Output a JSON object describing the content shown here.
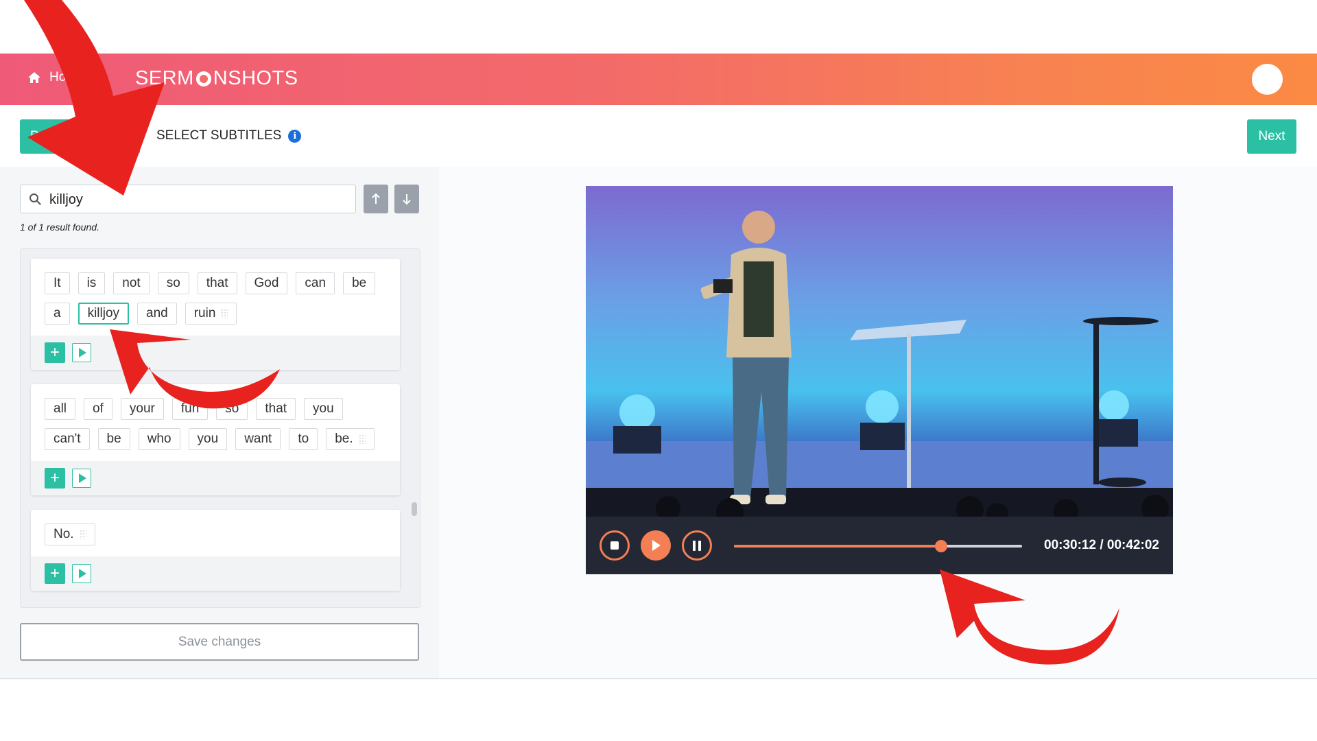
{
  "header": {
    "home_label": "Home",
    "logo_left": "SERM",
    "logo_right": "NSHOTS"
  },
  "toolbar": {
    "previous_label": "Previous",
    "step_title": "SELECT SUBTITLES",
    "info_icon": "info-icon",
    "next_label": "Next"
  },
  "search": {
    "value": "killjoy",
    "result_text": "1 of 1 result found."
  },
  "subtitles": [
    {
      "words": [
        "It",
        "is",
        "not",
        "so",
        "that",
        "God",
        "can",
        "be",
        "a",
        "killjoy",
        "and",
        "ruin"
      ],
      "highlight": "killjoy"
    },
    {
      "words": [
        "all",
        "of",
        "your",
        "fun",
        "so",
        "that",
        "you",
        "can't",
        "be",
        "who",
        "you",
        "want",
        "to",
        "be."
      ]
    },
    {
      "words": [
        "No."
      ]
    }
  ],
  "save_label": "Save changes",
  "player": {
    "current_time": "00:30:12",
    "duration": "00:42:02",
    "time_display": "00:30:12 / 00:42:02",
    "progress": 0.718
  },
  "colors": {
    "accent": "#2bbfa4",
    "player_accent": "#f47f54",
    "annotation": "#e8221e"
  }
}
